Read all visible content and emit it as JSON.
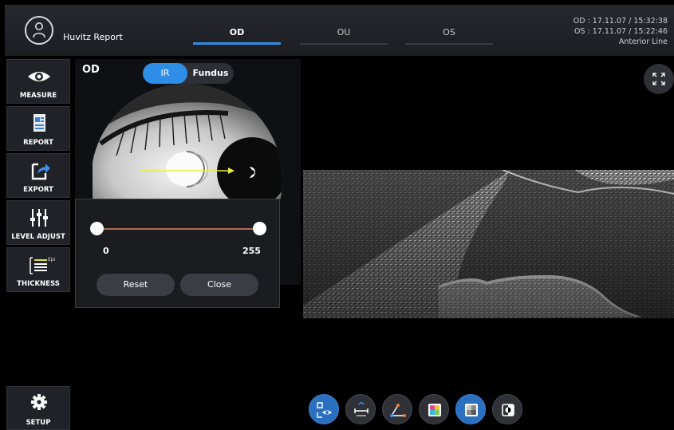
{
  "header": {
    "app_title": "Huvitz Report",
    "tabs": [
      {
        "label": "OD",
        "active": true
      },
      {
        "label": "OU",
        "active": false
      },
      {
        "label": "OS",
        "active": false
      }
    ],
    "info_lines": [
      "OD : 17.11.07 / 15:32:38",
      "OS : 17.11.07 / 15:22:46",
      "Anterior Line"
    ]
  },
  "sidebar": {
    "items": [
      {
        "label": "MEASURE",
        "icon": "eye-icon"
      },
      {
        "label": "REPORT",
        "icon": "report-icon"
      },
      {
        "label": "EXPORT",
        "icon": "export-icon"
      },
      {
        "label": "LEVEL ADJUST",
        "icon": "sliders-icon"
      },
      {
        "label": "THICKNESS",
        "icon": "thickness-icon",
        "sublabel": "Epi"
      }
    ],
    "setup_label": "SETUP"
  },
  "panel": {
    "eye_label": "OD",
    "toggle": {
      "options": [
        "IR",
        "Fundus"
      ],
      "selected": "IR"
    }
  },
  "level_popup": {
    "min_value": "0",
    "max_value": "255",
    "reset_label": "Reset",
    "close_label": "Close"
  },
  "toolbar": {
    "buttons": [
      {
        "icon": "eye-scan-icon",
        "active": true
      },
      {
        "icon": "caliper-icon",
        "active": false
      },
      {
        "icon": "angle-icon",
        "active": false
      },
      {
        "icon": "color-map-icon",
        "active": false
      },
      {
        "icon": "grayscale-icon",
        "active": true
      },
      {
        "icon": "invert-icon",
        "active": false
      }
    ]
  },
  "colors": {
    "accent": "#2e8de6",
    "slider_track": "#a86a58",
    "background": "#000000"
  }
}
